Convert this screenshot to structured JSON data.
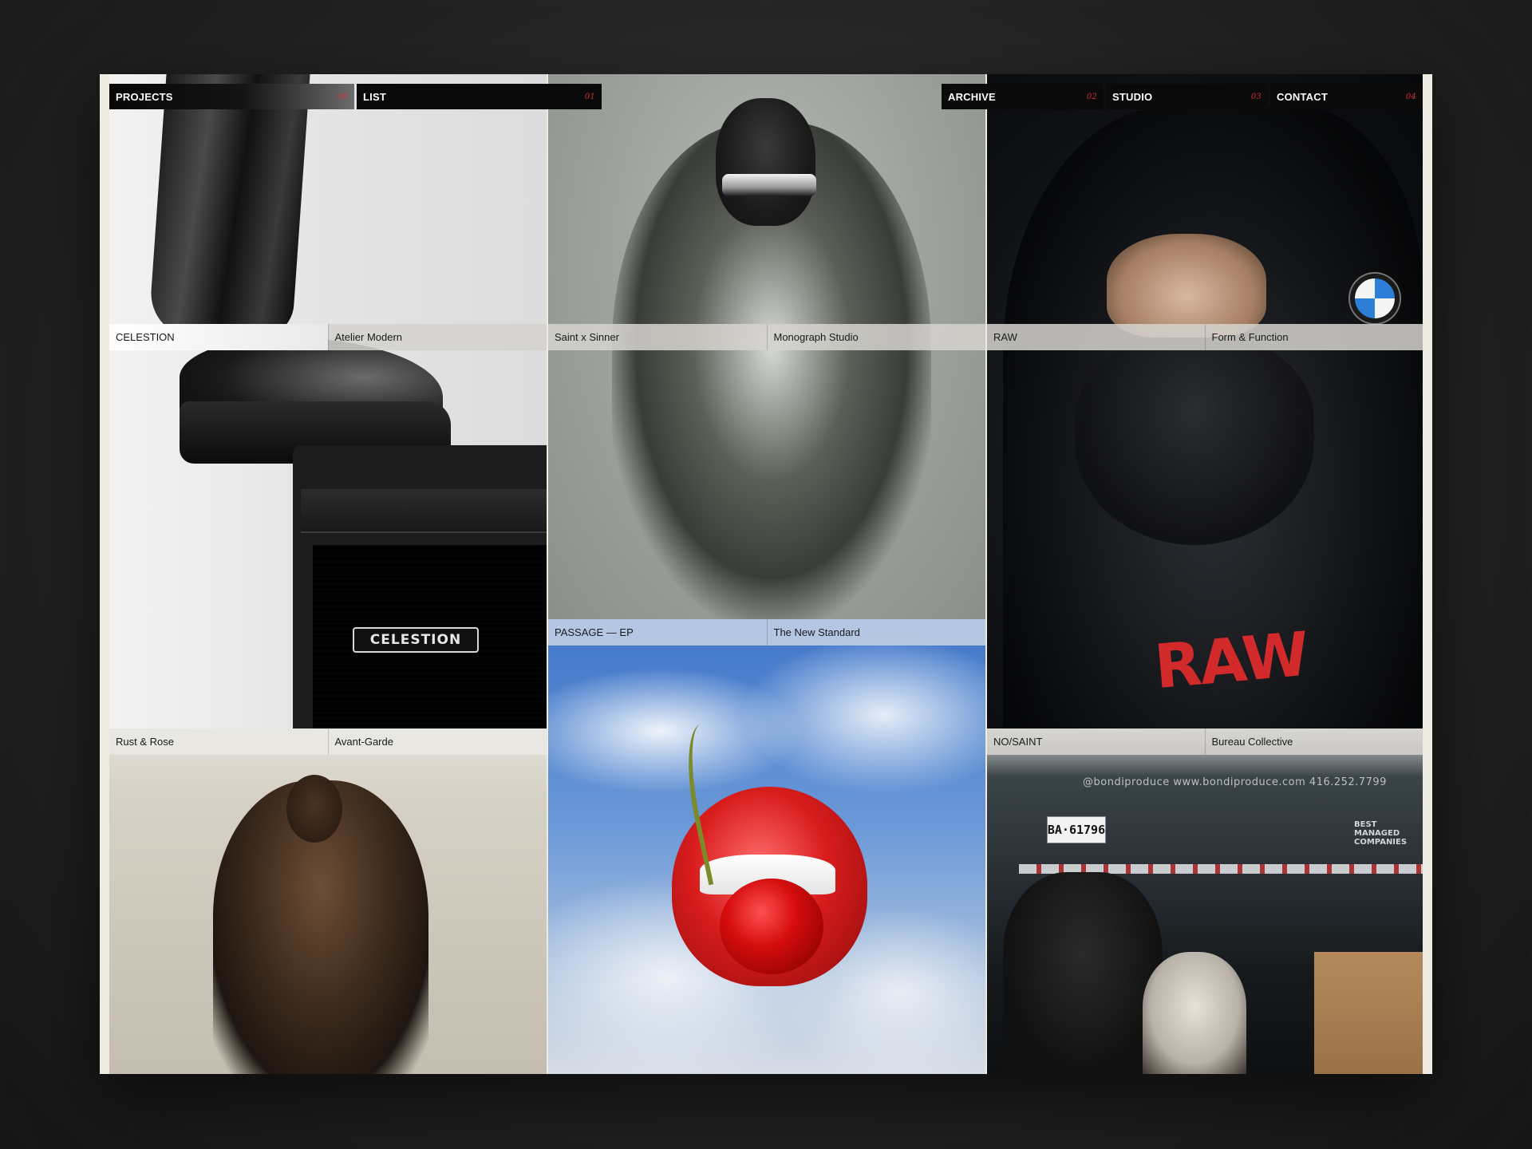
{
  "nav": {
    "items": [
      {
        "label": "PROJECTS",
        "num": "00"
      },
      {
        "label": "LIST",
        "num": "01"
      },
      {
        "label": "ARCHIVE",
        "num": "02"
      },
      {
        "label": "STUDIO",
        "num": "03"
      },
      {
        "label": "CONTACT",
        "num": "04"
      }
    ]
  },
  "projects": [
    {
      "title": "CELESTION",
      "client": "Atelier Modern",
      "image_text": "CELESTION"
    },
    {
      "title": "Saint x Sinner",
      "client": "Monograph Studio"
    },
    {
      "title": "RAW",
      "client": "Form & Function",
      "image_text": "RAW"
    },
    {
      "title": "PASSAGE — EP",
      "client": "The New Standard"
    },
    {
      "title": "Rust & Rose",
      "client": "Avant-Garde"
    },
    {
      "title": "NO/SAINT",
      "client": "Bureau Collective",
      "image_text": "@bondiproduce   www.bondiproduce.com   416.252.7799",
      "plate": "BA·61796",
      "badge": "BEST MANAGED COMPANIES"
    }
  ],
  "colors": {
    "page_bg": "#eeebe1",
    "nav_bg": "#0a0a0a",
    "nav_text": "#ffffff",
    "accent_red": "#d23030",
    "caption_bg": "#d5d3ce",
    "caption_blue": "#becee4"
  }
}
